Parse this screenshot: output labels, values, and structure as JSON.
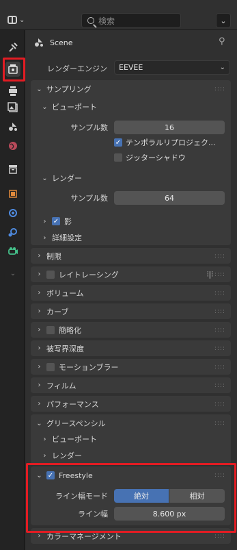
{
  "header": {
    "search_placeholder": "検索",
    "icons": [
      "editor-type-icon",
      "search-icon",
      "chevron-down-icon"
    ]
  },
  "tabs": [
    {
      "name": "tool-icon"
    },
    {
      "name": "render-icon",
      "active": true
    },
    {
      "name": "output-icon"
    },
    {
      "name": "view-layer-icon"
    },
    {
      "name": "scene-icon"
    },
    {
      "name": "world-icon"
    },
    {
      "name": "collection-icon"
    },
    {
      "name": "object-icon"
    },
    {
      "name": "modifier-icon"
    },
    {
      "name": "physics-icon"
    },
    {
      "name": "object-data-icon"
    },
    {
      "name": "expand-icon"
    }
  ],
  "context": {
    "label": "Scene"
  },
  "render_engine": {
    "label": "レンダーエンジン",
    "value": "EEVEE"
  },
  "sampling": {
    "title": "サンプリング",
    "viewport": {
      "title": "ビューポート",
      "samples_label": "サンプル数",
      "samples_value": "16",
      "temporal_label": "テンポラルリプロジェク...",
      "temporal_checked": true,
      "jitter_label": "ジッターシャドウ",
      "jitter_checked": false
    },
    "render": {
      "title": "レンダー",
      "samples_label": "サンプル数",
      "samples_value": "64"
    },
    "shadow": {
      "label": "影",
      "checked": true
    },
    "advanced": {
      "label": "詳細設定"
    }
  },
  "panels": [
    {
      "label": "制限",
      "checkbox": false
    },
    {
      "label": "レイトレーシング",
      "checkbox": true,
      "extra_icon": true
    },
    {
      "label": "ボリューム",
      "checkbox": false
    },
    {
      "label": "カーブ",
      "checkbox": false
    },
    {
      "label": "簡略化",
      "checkbox": true
    },
    {
      "label": "被写界深度",
      "checkbox": false
    },
    {
      "label": "モーションブラー",
      "checkbox": true
    },
    {
      "label": "フィルム",
      "checkbox": false
    },
    {
      "label": "パフォーマンス",
      "checkbox": false
    }
  ],
  "grease_pencil": {
    "title": "グリースペンシル",
    "viewport": "ビューポート",
    "render": "レンダー"
  },
  "freestyle": {
    "title": "Freestyle",
    "checked": true,
    "line_mode_label": "ライン幅モード",
    "mode_absolute": "絶対",
    "mode_relative": "相対",
    "line_width_label": "ライン幅",
    "line_width_value": "8.600 px"
  },
  "color_management": {
    "label": "カラーマネージメント"
  },
  "colors": {
    "accent": "#4772b3",
    "highlight": "#e21c23",
    "panel": "#3a3a3a",
    "background": "#303030"
  }
}
